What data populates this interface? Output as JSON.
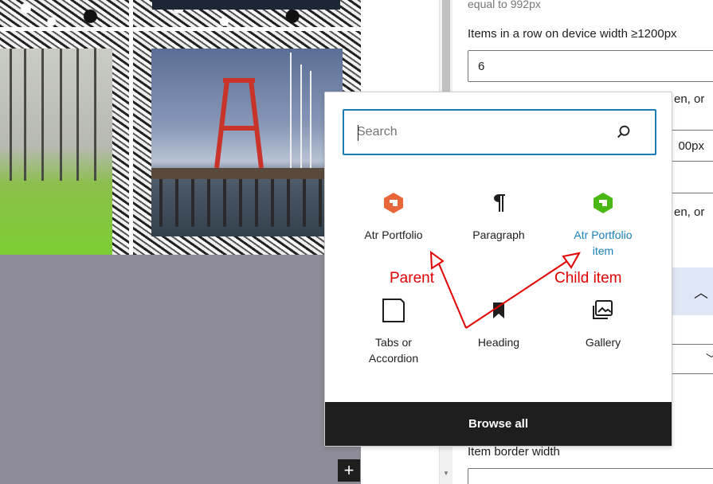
{
  "inserter": {
    "search": {
      "placeholder": "Search"
    },
    "blocks": [
      {
        "label_lines": [
          "Atr Portfolio"
        ],
        "icon": "atr-portfolio-icon",
        "icon_color": "#e8673a"
      },
      {
        "label_lines": [
          "Paragraph"
        ],
        "icon": "paragraph-icon",
        "icon_color": "#1e1e1e"
      },
      {
        "label_lines": [
          "Atr Portfolio",
          "item"
        ],
        "icon": "atr-portfolio-item-icon",
        "icon_color": "#4ab814",
        "highlighted": true
      },
      {
        "label_lines": [
          "Tabs or",
          "Accordion"
        ],
        "icon": "tabs-accordion-icon",
        "icon_color": "#1e1e1e"
      },
      {
        "label_lines": [
          "Heading"
        ],
        "icon": "heading-bookmark-icon",
        "icon_color": "#1e1e1e"
      },
      {
        "label_lines": [
          "Gallery"
        ],
        "icon": "gallery-icon",
        "icon_color": "#1e1e1e"
      }
    ],
    "browse_all_label": "Browse all",
    "accent_color": "#1a7fb8"
  },
  "sidebar": {
    "top_fragment": "equal to 992px",
    "items_row_label": "Items in a row on device width ≥1200px",
    "items_row_value": "6",
    "frag_1": "en, or",
    "frag_2": "00px",
    "frag_3": "en, or",
    "item_border_width_label": "Item border width"
  },
  "annotations": {
    "parent_label": "Parent",
    "child_label": "Child item",
    "color": "#e00000"
  },
  "canvas": {
    "add_block_symbol": "+"
  }
}
